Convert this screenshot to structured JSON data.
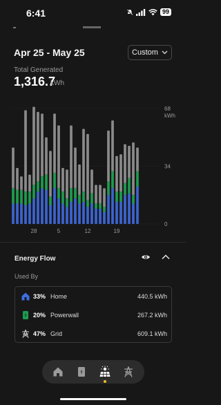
{
  "status": {
    "time": "6:41",
    "battery": "99"
  },
  "header": {
    "date_range": "Apr 25 - May 25",
    "custom_label": "Custom"
  },
  "summary": {
    "label": "Total Generated",
    "value": "1,316.7",
    "unit": "kWh"
  },
  "chart_data": {
    "type": "bar",
    "stacked": true,
    "categories": [
      "Apr 25",
      "Apr 26",
      "Apr 27",
      "Apr 28",
      "Apr 29",
      "Apr 30",
      "May 1",
      "May 2",
      "May 3",
      "May 4",
      "May 5",
      "May 6",
      "May 7",
      "May 8",
      "May 9",
      "May 10",
      "May 11",
      "May 12",
      "May 13",
      "May 14",
      "May 15",
      "May 16",
      "May 17",
      "May 18",
      "May 19",
      "May 20",
      "May 21",
      "May 22",
      "May 23",
      "May 24",
      "May 25"
    ],
    "x_tick_labels": [
      {
        "index": 5,
        "label": "28"
      },
      {
        "index": 11,
        "label": "5"
      },
      {
        "index": 18,
        "label": "12"
      },
      {
        "index": 25,
        "label": "19"
      }
    ],
    "series": [
      {
        "color": "#3c63cf",
        "values": [
          12,
          12,
          12,
          11,
          12,
          15,
          19,
          21,
          20,
          11,
          21,
          15,
          12,
          10,
          13,
          15,
          12,
          13,
          10,
          12,
          9,
          9,
          7,
          17,
          21,
          13,
          13,
          17,
          18,
          12,
          22
        ]
      },
      {
        "color": "#1f9a4f",
        "values": [
          9,
          8,
          8,
          8,
          7,
          8,
          6,
          7,
          9,
          5,
          9,
          6,
          7,
          5,
          8,
          6,
          5,
          6,
          4,
          6,
          3,
          3,
          3,
          8,
          10,
          6,
          6,
          7,
          9,
          5,
          9
        ]
      },
      {
        "color": "#8a8a8a",
        "values": [
          24,
          13,
          8,
          48,
          10,
          46,
          41,
          37,
          22,
          27,
          35,
          37,
          14,
          17,
          37,
          24,
          18,
          37,
          39,
          14,
          11,
          11,
          11,
          30,
          30,
          21,
          22,
          23,
          19,
          31,
          14
        ]
      }
    ],
    "y_ticks": [
      "0",
      "34",
      "68"
    ],
    "y_unit": "kWh",
    "ylim": [
      0,
      68
    ]
  },
  "energy_flow": {
    "title": "Energy Flow",
    "used_by_label": "Used By",
    "rows": [
      {
        "pct": "33%",
        "name": "Home",
        "value": "440.5 kWh"
      },
      {
        "pct": "20%",
        "name": "Powerwall",
        "value": "267.2 kWh"
      },
      {
        "pct": "47%",
        "name": "Grid",
        "value": "609.1 kWh"
      }
    ]
  },
  "colors": {
    "accent": "#f3c218",
    "solar_blue": "#3c63cf",
    "powerwall_green": "#1f9a4f",
    "grid_gray": "#8a8a8a"
  }
}
